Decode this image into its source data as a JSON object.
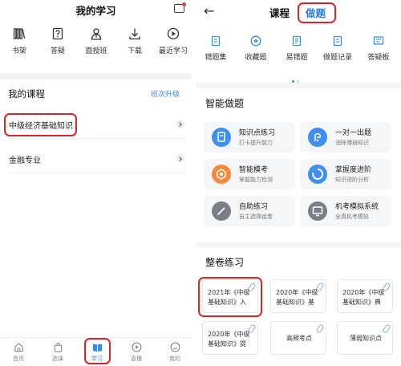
{
  "left": {
    "title": "我的学习",
    "shortcuts": [
      {
        "label": "书架",
        "icon": "bookshelf-icon"
      },
      {
        "label": "答疑",
        "icon": "question-doc-icon"
      },
      {
        "label": "面授班",
        "icon": "person-icon"
      },
      {
        "label": "下载",
        "icon": "download-icon"
      },
      {
        "label": "最近学习",
        "icon": "play-circle-icon"
      }
    ],
    "courses_heading": "我的课程",
    "class_upgrade": "班次升级",
    "courses": [
      {
        "label": "中级经济基础知识"
      },
      {
        "label": "金融专业"
      }
    ],
    "tabbar": [
      {
        "label": "首页",
        "icon": "home-icon"
      },
      {
        "label": "选课",
        "icon": "bag-icon"
      },
      {
        "label": "学习",
        "icon": "book-icon",
        "active": true
      },
      {
        "label": "直播",
        "icon": "play-icon"
      },
      {
        "label": "我的",
        "icon": "smile-icon"
      }
    ]
  },
  "right": {
    "tabs": [
      {
        "label": "课程"
      },
      {
        "label": "做题",
        "active": true
      }
    ],
    "tools": [
      {
        "label": "错题集"
      },
      {
        "label": "收藏题"
      },
      {
        "label": "易错题"
      },
      {
        "label": "做题记录"
      },
      {
        "label": "答疑板"
      }
    ],
    "smart_heading": "智能做题",
    "smart_cards": [
      {
        "title": "知识点练习",
        "subtitle": "打卡提升能力",
        "color": "#3f8ff0",
        "icon": "notebook-icon"
      },
      {
        "title": "一对一出题",
        "subtitle": "消除薄弱知识",
        "color": "#3f8ff0",
        "icon": "pen-icon"
      },
      {
        "title": "智能模考",
        "subtitle": "掌握能力检测",
        "color": "#f5893a",
        "icon": "target-icon"
      },
      {
        "title": "掌握度进阶",
        "subtitle": "知识进阶分析",
        "color": "#3f8ff0",
        "icon": "ring-icon"
      },
      {
        "title": "自助练习",
        "subtitle": "自主选择组卷",
        "color": "#7a7f87",
        "icon": "pencil-icon"
      },
      {
        "title": "机考模拟系统",
        "subtitle": "全真机考模拟",
        "color": "#7a7f87",
        "icon": "monitor-icon"
      }
    ],
    "papers_heading": "整卷练习",
    "papers": [
      {
        "line1": "2021年《中级",
        "line2": "基础知识》入"
      },
      {
        "line1": "2020年《中级",
        "line2": "基础知识》基"
      },
      {
        "line1": "2020年《中级",
        "line2": "基础知识》典"
      },
      {
        "line1": "2020年《中级",
        "line2": "基础知识》提"
      },
      {
        "line1": "高频考点",
        "line2": ""
      },
      {
        "line1": "薄弱知识点",
        "line2": ""
      }
    ]
  },
  "colors": {
    "accent": "#3a8be0",
    "highlight": "#d8262c",
    "orange": "#f5893a",
    "gray_icon": "#7a7f87"
  }
}
